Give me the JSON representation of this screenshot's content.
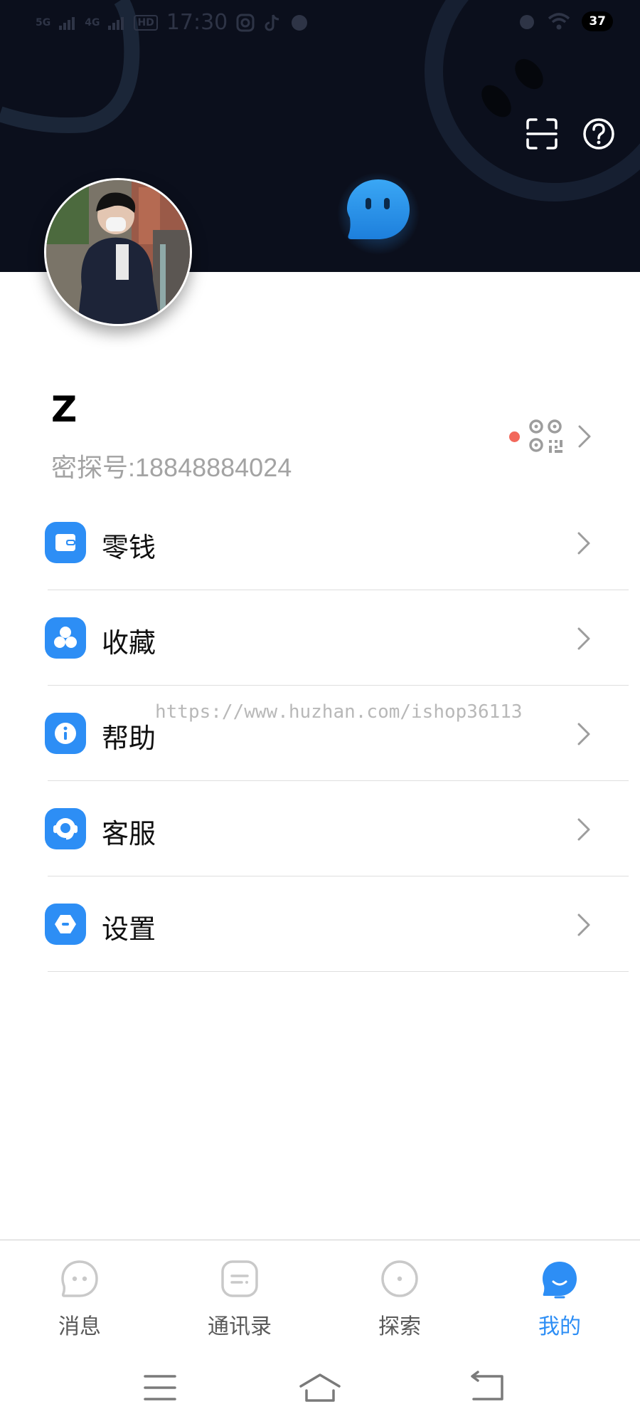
{
  "status_bar": {
    "signal_1": "5G",
    "signal_2": "4G",
    "hd_label": "HD",
    "time": "17:30",
    "battery": "37"
  },
  "header": {
    "scan_icon": "scan-icon",
    "help_icon": "question-icon",
    "mascot_icon": "chat-mascot-icon"
  },
  "profile": {
    "username": "Z",
    "account_id": "密探号:18848884024",
    "qr_icon": "qr-code-icon",
    "notification_dot_color": "#f2685b"
  },
  "menu": {
    "items": [
      {
        "label": "零钱",
        "icon": "wallet-icon"
      },
      {
        "label": "收藏",
        "icon": "favorites-icon"
      },
      {
        "label": "帮助",
        "icon": "info-icon"
      },
      {
        "label": "客服",
        "icon": "headset-icon"
      },
      {
        "label": "设置",
        "icon": "settings-icon"
      }
    ]
  },
  "watermark": "https://www.huzhan.com/ishop36113",
  "tabbar": {
    "tabs": [
      {
        "label": "消息",
        "icon": "message-icon",
        "active": false
      },
      {
        "label": "通讯录",
        "icon": "contacts-icon",
        "active": false
      },
      {
        "label": "探索",
        "icon": "explore-icon",
        "active": false
      },
      {
        "label": "我的",
        "icon": "me-icon",
        "active": true
      }
    ]
  },
  "colors": {
    "accent": "#2d8ef5",
    "header_bg": "#0b0f1c"
  }
}
